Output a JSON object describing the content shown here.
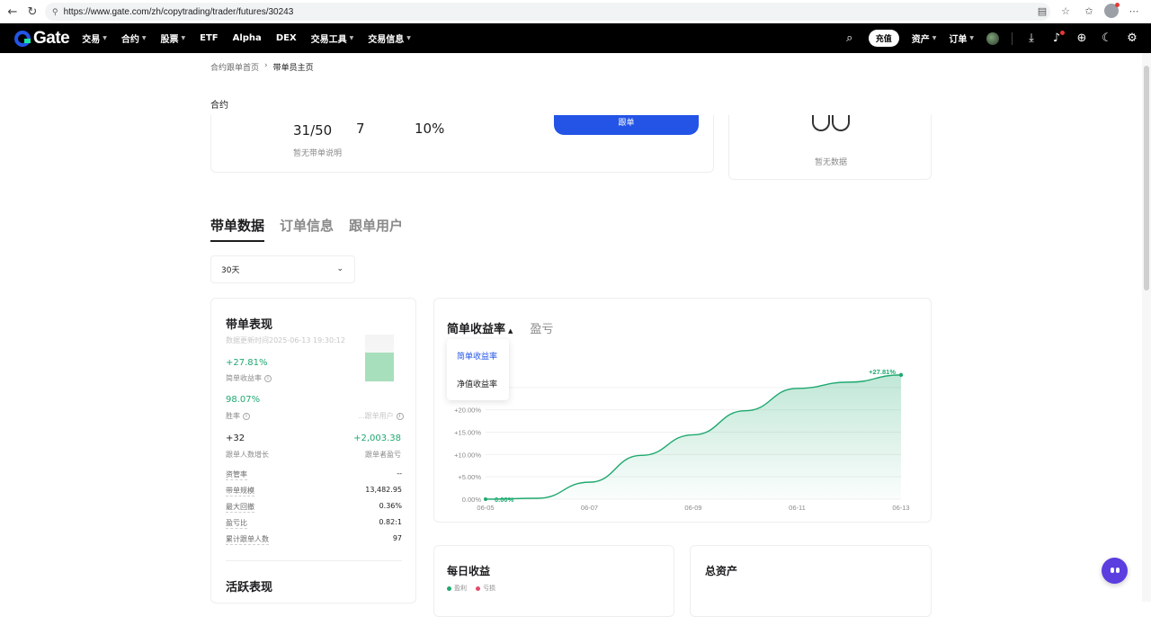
{
  "browser": {
    "url": "https://www.gate.com/zh/copytrading/trader/futures/30243"
  },
  "header": {
    "logo_text": "Gate",
    "nav": [
      {
        "label": "交易",
        "caret": true
      },
      {
        "label": "合约",
        "caret": true
      },
      {
        "label": "股票",
        "caret": true
      },
      {
        "label": "ETF",
        "caret": false
      },
      {
        "label": "Alpha",
        "caret": false
      },
      {
        "label": "DEX",
        "caret": false
      },
      {
        "label": "交易工具",
        "caret": true
      },
      {
        "label": "交易信息",
        "caret": true
      }
    ],
    "deposit_label": "充值",
    "assets_label": "资产",
    "orders_label": "订单"
  },
  "breadcrumb": {
    "home": "合约跟单首页",
    "separator": "›",
    "current": "带单员主页"
  },
  "contract_tab": "合约",
  "top_card": {
    "followers": "31/50",
    "days": "7",
    "ratio": "10%",
    "no_description": "暂无带单说明",
    "follow_button": "跟单"
  },
  "side_card": {
    "empty_text": "暂无数据"
  },
  "section_tabs": [
    "带单数据",
    "订单信息",
    "跟单用户"
  ],
  "period": {
    "value": "30天"
  },
  "performance": {
    "title": "带单表现",
    "updated": "数据更新时间2025-06-13 19:30:12",
    "simple_return": "+27.81%",
    "simple_return_label": "简单收益率",
    "win_rate": "98.07%",
    "win_rate_label": "胜率",
    "follower_profit_label": "...跟单用户",
    "follower_growth": "+32",
    "follower_growth_label": "跟单人数增长",
    "follower_pnl": "+2,003.38",
    "follower_pnl_label": "跟单者盈亏",
    "rows": [
      {
        "k": "资管率",
        "v": "--"
      },
      {
        "k": "带单规模",
        "v": "13,482.95"
      },
      {
        "k": "最大回撤",
        "v": "0.36%"
      },
      {
        "k": "盈亏比",
        "v": "0.82:1"
      },
      {
        "k": "累计跟单人数",
        "v": "97"
      }
    ],
    "active_title": "活跃表现"
  },
  "chart_panel": {
    "tab_return": "简单收益率",
    "tab_pnl": "盈亏",
    "dropdown": [
      "简单收益率",
      "净值收益率"
    ]
  },
  "chart_data": {
    "type": "area",
    "x": [
      "06-05",
      "06-06",
      "06-07",
      "06-08",
      "06-09",
      "06-10",
      "06-11",
      "06-12",
      "06-13"
    ],
    "values": [
      0,
      0.2,
      3.8,
      9.8,
      14.4,
      19.8,
      24.8,
      26.2,
      27.81
    ],
    "yticks": [
      "0.00%",
      "+5.00%",
      "+10.00%",
      "+15.00%",
      "+20.00%"
    ],
    "xticks": [
      "06-05",
      "06-07",
      "06-09",
      "06-11",
      "06-13"
    ],
    "ylim": [
      0,
      30
    ],
    "start_label": "0.00%",
    "end_label": "+27.81%",
    "color": "#1fa970"
  },
  "daily": {
    "title": "每日收益",
    "legend_profit": "盈利",
    "legend_loss": "亏损",
    "profit_color": "#1fa970",
    "loss_color": "#e24b6b"
  },
  "assets_card": {
    "title": "总资产"
  }
}
